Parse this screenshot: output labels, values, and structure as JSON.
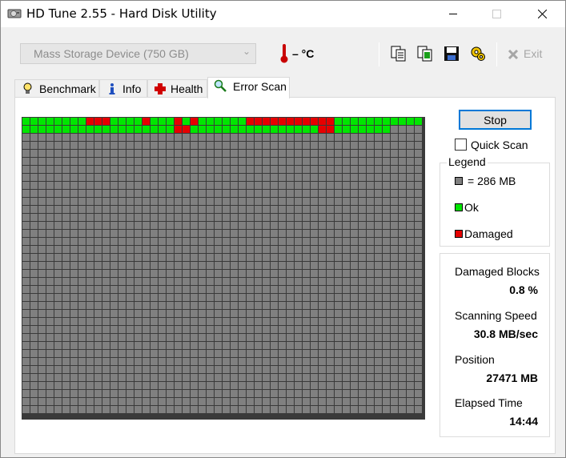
{
  "window": {
    "title": "HD Tune 2.55 - Hard Disk Utility"
  },
  "toolbar": {
    "device": "Mass Storage Device (750 GB)",
    "temperature": "– °C",
    "exit_label": "Exit",
    "icons": [
      "copy-text-icon",
      "copy-image-icon",
      "save-icon",
      "options-icon",
      "exit-icon"
    ]
  },
  "tabs": [
    {
      "label": "Benchmark",
      "icon": "lightbulb-icon"
    },
    {
      "label": "Info",
      "icon": "info-icon"
    },
    {
      "label": "Health",
      "icon": "health-cross-icon"
    },
    {
      "label": "Error Scan",
      "icon": "magnifier-icon",
      "active": true
    }
  ],
  "scan": {
    "stop_label": "Stop",
    "quick_scan_label": "Quick Scan",
    "quick_scan_checked": false,
    "legend_title": "Legend",
    "legend": [
      {
        "label": "= 286 MB",
        "color": "#808080"
      },
      {
        "label": "Ok",
        "color": "#00e600"
      },
      {
        "label": "Damaged",
        "color": "#e60000"
      }
    ],
    "stats": [
      {
        "label": "Damaged Blocks",
        "value": "0.8 %"
      },
      {
        "label": "Scanning Speed",
        "value": "30.8 MB/sec"
      },
      {
        "label": "Position",
        "value": "27471 MB"
      },
      {
        "label": "Elapsed Time",
        "value": "14:44"
      }
    ],
    "grid": {
      "columns": 50,
      "rows": 37,
      "colors": {
        "pending": "#808080",
        "ok": "#00e600",
        "damaged": "#e60000"
      },
      "row0": "GGGGGGGGRRRGGGGRGGGRGRGGGGGGRRRRRRRRRRRGGGGGGGGGGG",
      "row1": "GGGGGGGGGGGGGGGGGGGRRGGGGGGGGGGGGGGGGRRGGGGGGG"
    }
  }
}
